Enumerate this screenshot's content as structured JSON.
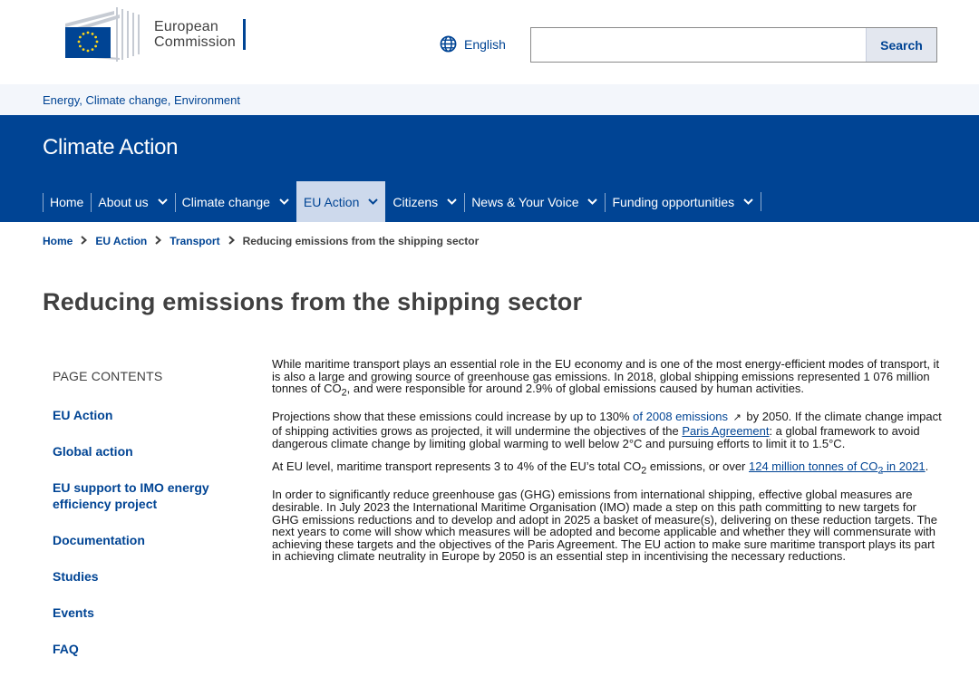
{
  "header": {
    "logo_line1": "European",
    "logo_line2": "Commission",
    "language": "English",
    "search_placeholder": "",
    "search_button": "Search"
  },
  "site_group": "Energy, Climate change, Environment",
  "site_title": "Climate Action",
  "menu": {
    "items": [
      {
        "label": "Home"
      },
      {
        "label": "About us"
      },
      {
        "label": "Climate change"
      },
      {
        "label": "EU Action"
      },
      {
        "label": "Citizens"
      },
      {
        "label": "News & Your Voice"
      },
      {
        "label": "Funding opportunities"
      }
    ]
  },
  "breadcrumb": {
    "items": [
      "Home",
      "EU Action",
      "Transport"
    ],
    "current": "Reducing emissions from the shipping sector"
  },
  "page_title": "Reducing emissions from the shipping sector",
  "sidebar": {
    "heading": "PAGE CONTENTS",
    "items": [
      {
        "label": "EU Action"
      },
      {
        "label": "Global action"
      },
      {
        "label": "EU support to IMO energy efficiency project"
      },
      {
        "label": "Documentation"
      },
      {
        "label": "Studies"
      },
      {
        "label": "Events"
      },
      {
        "label": "FAQ"
      }
    ]
  },
  "content": {
    "p1": {
      "before": "While maritime transport plays an essential role in the EU economy and is one of the most energy-efficient modes of transport, it is also a large and growing source of greenhouse gas emissions. In 2018, global shipping emissions represented 1 076 million tonnes of CO",
      "sub": "2",
      "after": ", and were responsible for around 2.9% of global emissions caused by human activities."
    },
    "p2": {
      "before": "Projections show that these emissions could increase by up to 130% ",
      "link1": "of 2008 emissions",
      "ext_icon": "↗",
      "middle": " by 2050. If the climate change impact of shipping activities grows as projected, it will undermine the objectives of the ",
      "link2": "Paris Agreement",
      "after": ": a global framework to avoid dangerous climate change by limiting global warming to well below 2°C and pursuing efforts to limit it to 1.5°C."
    },
    "p3": {
      "before": "At EU level, maritime transport represents 3 to 4% of the EU’s total CO",
      "sub": "2",
      "middle": " emissions, or over ",
      "link_a": "124 million tonnes of CO",
      "link_sub": "2",
      "link_b": " in 2021",
      "after": "."
    },
    "p4": "In order to significantly reduce greenhouse gas (GHG) emissions from international shipping, effective global measures are desirable. In July 2023 the International Maritime Organisation (IMO) made a step on this path committing to new targets for GHG emissions reductions and to develop and adopt in 2025 a basket of measure(s), delivering on these reduction targets. The next years to come will show which measures will be adopted and become applicable and whether they will commensurate with achieving these targets and the objectives of the Paris Agreement. The EU action to make sure maritime transport plays its part in achieving climate neutrality in Europe by 2050 is an essential step in incentivising the necessary reductions."
  },
  "colors": {
    "brand_blue": "#004494",
    "active_menu_bg": "#cdd9ec",
    "site_group_bg": "#f3f6fb",
    "flag_yellow": "#ffd617"
  },
  "icons": {
    "globe": "globe-icon",
    "chevron": "chevron-down-icon",
    "breadcrumb_sep": "chevron-right-icon",
    "external": "external-link-icon"
  }
}
